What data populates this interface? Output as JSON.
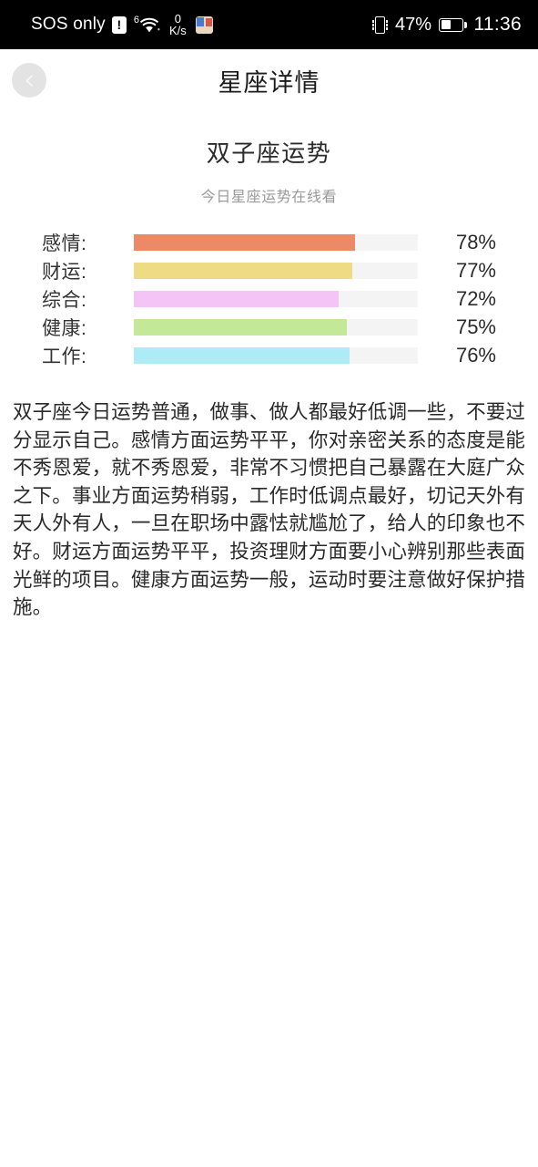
{
  "status_bar": {
    "carrier": "SOS only",
    "alert_badge": "!",
    "wifi_generation": "6",
    "wifi_icon": "wifi-icon",
    "network_speed_value": "0",
    "network_speed_unit": "K/s",
    "app_icon": "app-notification-icon",
    "vibrate_icon": "vibrate-mode-icon",
    "battery_percent": "47%",
    "battery_level": 47,
    "clock": "11:36"
  },
  "header": {
    "back_icon": "chevron-left-icon",
    "title": "星座详情"
  },
  "heading": {
    "title": "双子座运势",
    "subtitle": "今日星座运势在线看"
  },
  "stats": {
    "rows": [
      {
        "label": "感情:",
        "value": "78%",
        "percent": 78,
        "color": "#ec8a68"
      },
      {
        "label": "财运:",
        "value": "77%",
        "percent": 77,
        "color": "#eedc84"
      },
      {
        "label": "综合:",
        "value": "72%",
        "percent": 72,
        "color": "#f5c4f7"
      },
      {
        "label": "健康:",
        "value": "75%",
        "percent": 75,
        "color": "#c2e898"
      },
      {
        "label": "工作:",
        "value": "76%",
        "percent": 76,
        "color": "#adecf7"
      }
    ],
    "track_color": "#f4f4f4"
  },
  "description": {
    "text": "双子座今日运势普通，做事、做人都最好低调一些，不要过分显示自己。感情方面运势平平，你对亲密关系的态度是能不秀恩爱，就不秀恩爱，非常不习惯把自己暴露在大庭广众之下。事业方面运势稍弱，工作时低调点最好，切记天外有天人外有人，一旦在职场中露怯就尴尬了，给人的印象也不好。财运方面运势平平，投资理财方面要小心辨别那些表面光鲜的项目。健康方面运势一般，运动时要注意做好保护措施。"
  },
  "chart_data": {
    "type": "bar",
    "title": "双子座运势",
    "subtitle": "今日星座运势在线看",
    "categories": [
      "感情",
      "财运",
      "综合",
      "健康",
      "工作"
    ],
    "values": [
      78,
      77,
      72,
      75,
      76
    ],
    "value_labels": [
      "78%",
      "77%",
      "72%",
      "75%",
      "76%"
    ],
    "colors": [
      "#ec8a68",
      "#eedc84",
      "#f5c4f7",
      "#c2e898",
      "#adecf7"
    ],
    "xlabel": "",
    "ylabel": "",
    "ylim": [
      0,
      100
    ],
    "orientation": "horizontal",
    "grid": false,
    "legend": "none"
  }
}
